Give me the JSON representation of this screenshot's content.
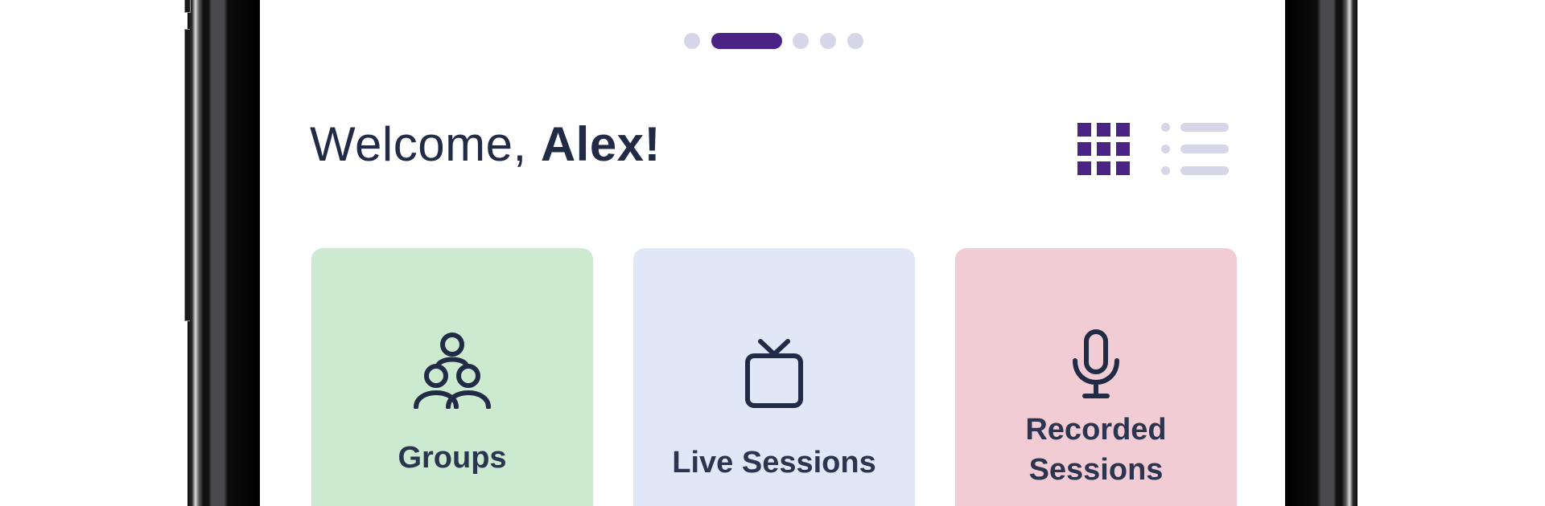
{
  "pager": {
    "count": 5,
    "active_index": 1
  },
  "header": {
    "greeting": "Welcome, ",
    "user_name": "Alex!"
  },
  "view_toggle": {
    "grid_icon": "grid-view-icon",
    "list_icon": "list-view-icon",
    "selected": "grid"
  },
  "cards": [
    {
      "label": "Groups",
      "icon": "groups-icon",
      "color": "#cbead0"
    },
    {
      "label": "Live Sessions",
      "icon": "tv-icon",
      "color": "#e0e8f7"
    },
    {
      "label_line1": "Recorded",
      "label_line2": "Sessions",
      "icon": "microphone-icon",
      "color": "#f1ccd4"
    }
  ],
  "colors": {
    "accent": "#4b2384",
    "inactive": "#d6d6e8",
    "text": "#222b45"
  }
}
